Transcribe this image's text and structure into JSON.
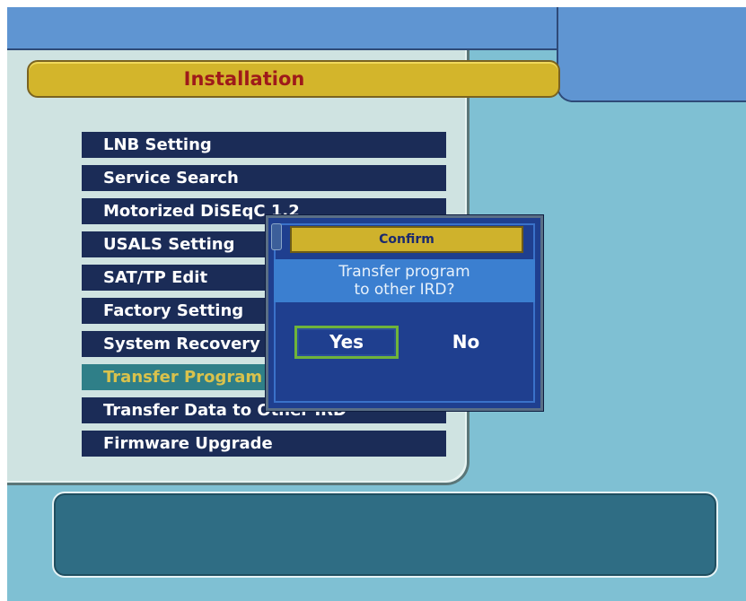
{
  "header": {
    "title": "Installation"
  },
  "menu": {
    "items": [
      {
        "label": "LNB Setting"
      },
      {
        "label": "Service Search"
      },
      {
        "label": "Motorized DiSEqC 1.2"
      },
      {
        "label": "USALS Setting"
      },
      {
        "label": "SAT/TP Edit"
      },
      {
        "label": "Factory Setting"
      },
      {
        "label": "System Recovery"
      },
      {
        "label": "Transfer Program"
      },
      {
        "label": "Transfer Data to Other IRD"
      },
      {
        "label": "Firmware Upgrade"
      }
    ],
    "selected_index": 7
  },
  "dialog": {
    "title": "Confirm",
    "message_line1": "Transfer program",
    "message_line2": "to other IRD?",
    "yes_label": "Yes",
    "no_label": "No",
    "focused": "Yes"
  },
  "colors": {
    "background": "#7fc0d3",
    "title_bar": "#d3b52b",
    "title_text": "#9e1a1a",
    "menu_item": "#1b2c57",
    "menu_selected": "#2f7f88",
    "dialog": "#1f3f8f",
    "focus_border": "#6fb43a"
  }
}
